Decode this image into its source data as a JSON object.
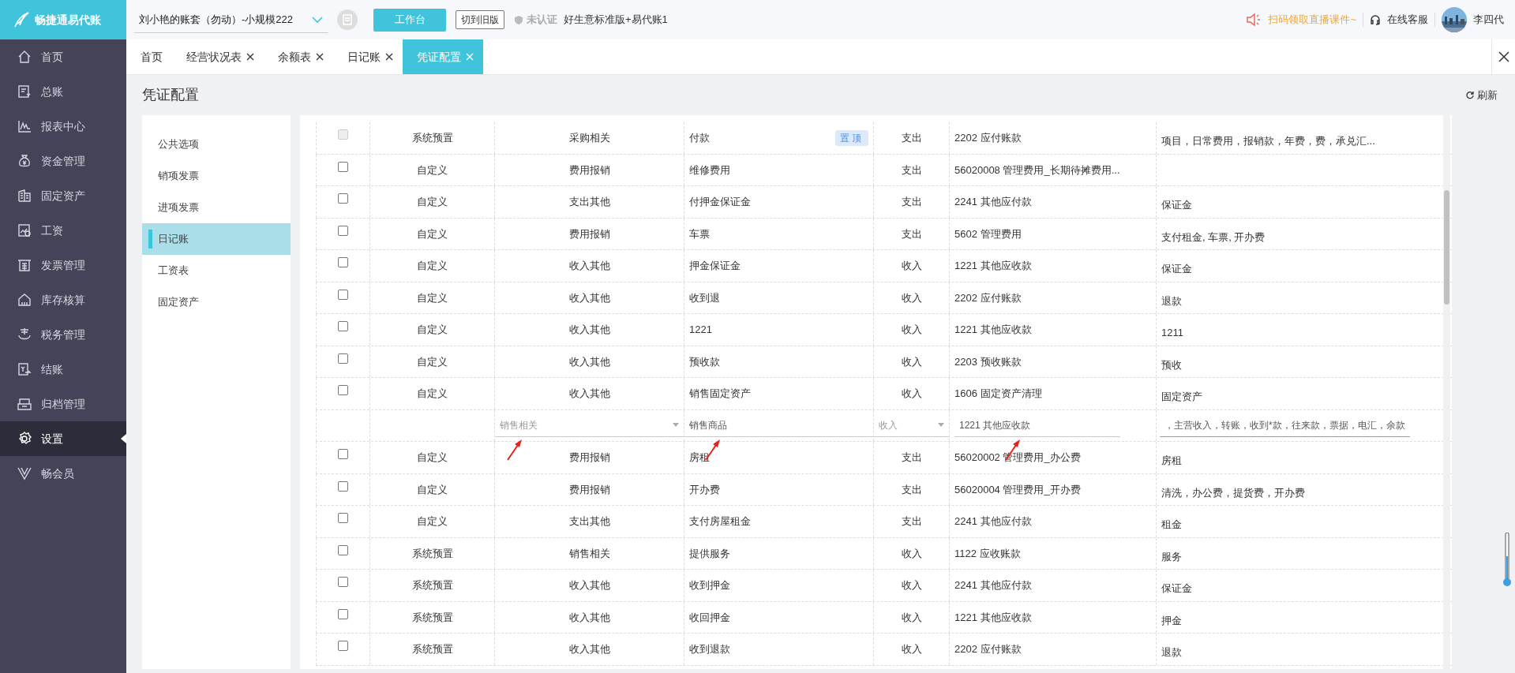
{
  "brand": {
    "name": "畅捷通易代账"
  },
  "topbar": {
    "account": "刘小艳的账套（勿动）-小规模222",
    "workbench_button": "工作台",
    "switch_button": "切到旧版",
    "certification": "未认证",
    "plan": "好生意标准版+易代账1",
    "promo": "扫码领取直播课件~",
    "support": "在线客服",
    "user": "李四代"
  },
  "nav": [
    {
      "label": "首页",
      "selected": false
    },
    {
      "label": "总账",
      "selected": false
    },
    {
      "label": "报表中心",
      "selected": false
    },
    {
      "label": "资金管理",
      "selected": false
    },
    {
      "label": "固定资产",
      "selected": false
    },
    {
      "label": "工资",
      "selected": false
    },
    {
      "label": "发票管理",
      "selected": false
    },
    {
      "label": "库存核算",
      "selected": false
    },
    {
      "label": "税务管理",
      "selected": false
    },
    {
      "label": "结账",
      "selected": false
    },
    {
      "label": "归档管理",
      "selected": false
    },
    {
      "label": "设置",
      "selected": true
    },
    {
      "label": "畅会员",
      "selected": false
    }
  ],
  "tabs": [
    {
      "label": "首页",
      "selected": false,
      "closable": false
    },
    {
      "label": "经营状况表",
      "selected": false,
      "closable": true
    },
    {
      "label": "余额表",
      "selected": false,
      "closable": true
    },
    {
      "label": "日记账",
      "selected": false,
      "closable": true
    },
    {
      "label": "凭证配置",
      "selected": true,
      "closable": true
    }
  ],
  "page": {
    "title": "凭证配置",
    "refresh": "刷新"
  },
  "settings_menu": [
    {
      "label": "公共选项",
      "selected": false
    },
    {
      "label": "销项发票",
      "selected": false
    },
    {
      "label": "进项发票",
      "selected": false
    },
    {
      "label": "日记账",
      "selected": true
    },
    {
      "label": "工资表",
      "selected": false
    },
    {
      "label": "固定资产",
      "selected": false
    }
  ],
  "table": {
    "rows": [
      {
        "kind": "row",
        "disabled": true,
        "source": "系统预置",
        "category": "采购相关",
        "name": "付款",
        "pin": "置顶",
        "direction": "支出",
        "account": "2202 应付账款",
        "keywords": "项目，日常费用，报销款，年费，费，承兑汇..."
      },
      {
        "kind": "row",
        "disabled": false,
        "source": "自定义",
        "category": "费用报销",
        "name": "维修费用",
        "direction": "支出",
        "account": "56020008 管理费用_长期待摊费用..."
      },
      {
        "kind": "row",
        "disabled": false,
        "source": "自定义",
        "category": "支出其他",
        "name": "付押金保证金",
        "direction": "支出",
        "account": "2241 其他应付款",
        "keywords": "保证金"
      },
      {
        "kind": "row",
        "disabled": false,
        "source": "自定义",
        "category": "费用报销",
        "name": "车票",
        "direction": "支出",
        "account": "5602 管理费用",
        "keywords": "支付租金, 车票, 开办费"
      },
      {
        "kind": "row",
        "disabled": false,
        "source": "自定义",
        "category": "收入其他",
        "name": "押金保证金",
        "direction": "收入",
        "account": "1221 其他应收款",
        "keywords": "保证金"
      },
      {
        "kind": "row",
        "disabled": false,
        "source": "自定义",
        "category": "收入其他",
        "name": "收到退",
        "direction": "收入",
        "account": "2202 应付账款",
        "keywords": "退款"
      },
      {
        "kind": "row",
        "disabled": false,
        "source": "自定义",
        "category": "收入其他",
        "name": "1221",
        "direction": "收入",
        "account": "1221 其他应收款",
        "keywords": "1211"
      },
      {
        "kind": "row",
        "disabled": false,
        "source": "自定义",
        "category": "收入其他",
        "name": "预收款",
        "direction": "收入",
        "account": "2203 预收账款",
        "keywords": "预收"
      },
      {
        "kind": "row",
        "disabled": false,
        "source": "自定义",
        "category": "收入其他",
        "name": "销售固定资产",
        "direction": "收入",
        "account": "1606 固定资产清理",
        "keywords": "固定资产"
      },
      {
        "kind": "edit",
        "category": "销售相关",
        "name": "销售商品",
        "direction": "收入",
        "account": "1221 其他应收款",
        "keywords": "，主营收入，转账，收到*款，往来款，票据，电汇，余款",
        "focused": true
      },
      {
        "kind": "row",
        "disabled": false,
        "source": "自定义",
        "category": "费用报销",
        "name": "房租",
        "direction": "支出",
        "account": "56020002 管理费用_办公费",
        "keywords": "房租"
      },
      {
        "kind": "row",
        "disabled": false,
        "source": "自定义",
        "category": "费用报销",
        "name": "开办费",
        "direction": "支出",
        "account": "56020004 管理费用_开办费",
        "keywords": "清洗，办公费，提货费，开办费"
      },
      {
        "kind": "row",
        "disabled": false,
        "source": "自定义",
        "category": "支出其他",
        "name": "支付房屋租金",
        "direction": "支出",
        "account": "2241 其他应付款",
        "keywords": "租金"
      },
      {
        "kind": "row",
        "disabled": false,
        "source": "系统预置",
        "category": "销售相关",
        "name": "提供服务",
        "direction": "收入",
        "account": "1122 应收账款",
        "keywords": "服务"
      },
      {
        "kind": "row",
        "disabled": false,
        "source": "系统预置",
        "category": "收入其他",
        "name": "收到押金",
        "direction": "收入",
        "account": "2241 其他应付款",
        "keywords": "保证金"
      },
      {
        "kind": "row",
        "disabled": false,
        "source": "系统预置",
        "category": "收入其他",
        "name": "收回押金",
        "direction": "收入",
        "account": "1221 其他应收款",
        "keywords": "押金"
      },
      {
        "kind": "row",
        "disabled": false,
        "source": "系统预置",
        "category": "收入其他",
        "name": "收到退款",
        "direction": "收入",
        "account": "2202 应付账款",
        "keywords": "退款"
      }
    ]
  }
}
